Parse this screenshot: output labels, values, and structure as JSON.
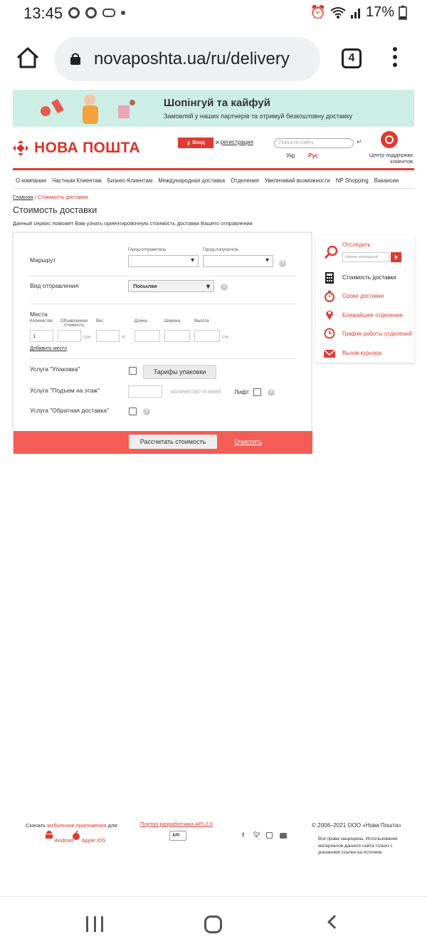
{
  "status_bar": {
    "time": "13:45",
    "battery": "17%",
    "icons": [
      "chrome-icon",
      "chrome-icon",
      "cast-icon",
      "dot-icon",
      "alarm-icon",
      "wifi-icon",
      "signal-icon",
      "battery-icon"
    ]
  },
  "browser": {
    "url": "novaposhta.ua/ru/delivery",
    "tab_count": "4"
  },
  "banner": {
    "title": "Шопінгуй та кайфуй",
    "subtitle": "Замовляй у наших партнерів та отримуй безкоштовну доставку",
    "background": "#cdeee5"
  },
  "header": {
    "logo_text": "НОВА ПОШТА",
    "login_label": "Вход",
    "register_prefix": "и ",
    "register_label": "регистрация",
    "search_placeholder": "Поиск по сайту",
    "lang_ukr": "Укр",
    "lang_rus": "Рус",
    "support_label": "Центр поддержки клиентов",
    "accent_color": "#e03b32"
  },
  "nav": {
    "items": [
      "О компании",
      "Частным Клиентам",
      "Бизнес-Клиентам",
      "Международная доставка",
      "Отделения",
      "Увеличивай возможности",
      "NP Shopping",
      "Вакансии"
    ]
  },
  "breadcrumb": {
    "home": "Главная",
    "separator": " / ",
    "current": "Стоимость доставки"
  },
  "page": {
    "title": "Стоимость доставки",
    "description": "Данный сервис поможет Вам узнать ориентировочную стоимость доставки Вашего отправления"
  },
  "form": {
    "route_label": "Маршрут",
    "city_from_label": "Город-отправитель",
    "city_to_label": "Город-получатель",
    "shipment_type_label": "Вид отправления",
    "shipment_type_value": "Посылки",
    "places_label": "Места",
    "col_quantity": "Количество",
    "col_declared": "Объявленная стоимость",
    "col_weight": "Вес",
    "col_length": "Длина",
    "col_width": "Ширина",
    "col_height": "Высота",
    "quantity_value": "1",
    "unit_uah": "грн",
    "unit_kg": "кг",
    "unit_cm": "см",
    "add_place": "Добавить место",
    "packing_label": "Услуга \"Упаковка\"",
    "packing_tariffs_button": "Тарифы упаковки",
    "floor_lift_label": "Услуга \"Подъем на этаж\"",
    "floors_placeholder": "количество этажей",
    "lift_label": "Лифт",
    "return_delivery_label": "Услуга \"Обратная доставка\"",
    "calculate_button": "Рассчитать стоимость",
    "clear_link": "Очистить",
    "bar_color": "#f35d55"
  },
  "sidebar": {
    "track_label": "Отследить",
    "track_placeholder": "Номер накладной",
    "items": [
      {
        "label": "Стоимость доставки",
        "icon": "calculator-icon"
      },
      {
        "label": "Сроки доставки",
        "icon": "stopwatch-icon"
      },
      {
        "label": "Ближайшее отделение",
        "icon": "map-pin-icon"
      },
      {
        "label": "График работы отделений",
        "icon": "clock-icon"
      },
      {
        "label": "Вызов курьера",
        "icon": "envelope-icon"
      }
    ]
  },
  "footer": {
    "download_prefix": "Скачать ",
    "download_link": "мобильное приложения",
    "download_suffix": " для:",
    "android": "Android",
    "ios": "Apple iOS",
    "api_portal": "Портал разработчика API 2.0",
    "api_badge": "API",
    "social": [
      "f",
      "t",
      "in",
      "yt"
    ],
    "copyright": "© 2006–2021 ООО «Нова Пошта»",
    "rights": "Все права защищены. Использование материалов данного сайта только с указанием ссылки на источник."
  }
}
